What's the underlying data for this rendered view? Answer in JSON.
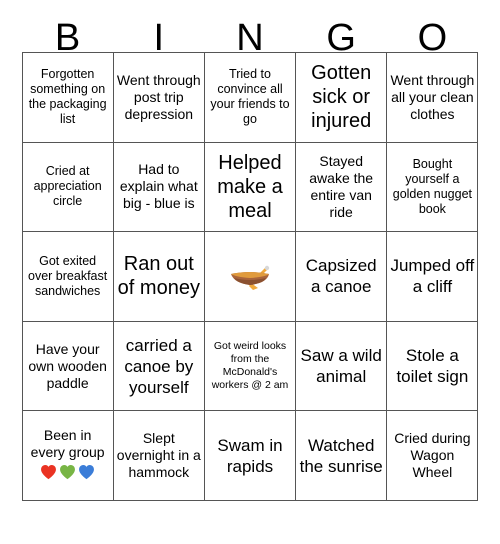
{
  "header": {
    "letters": [
      "B",
      "I",
      "N",
      "G",
      "O"
    ]
  },
  "colors": {
    "grid_border": "#555555",
    "text": "#000000",
    "background": "#ffffff",
    "heart_red": "#ea3323",
    "heart_green": "#78b545",
    "heart_blue": "#3b7dd8",
    "canoe_hull": "#a9643b",
    "canoe_hull_dark": "#8b5130",
    "canoe_inner": "#e09b3d",
    "canoe_paddle": "#f0a93c"
  },
  "grid": {
    "rows": [
      [
        {
          "text": "Forgotten something on the packaging list",
          "size": "fs-sm",
          "kind": "text"
        },
        {
          "text": "Went through post trip depression",
          "size": "fs-md",
          "kind": "text"
        },
        {
          "text": "Tried to convince all your friends to go",
          "size": "fs-sm",
          "kind": "text"
        },
        {
          "text": "Gotten sick or injured",
          "size": "fs-xl",
          "kind": "text"
        },
        {
          "text": "Went through all your clean clothes",
          "size": "fs-md",
          "kind": "text"
        }
      ],
      [
        {
          "text": "Cried at appreciation circle",
          "size": "fs-sm",
          "kind": "text"
        },
        {
          "text": "Had to explain what big - blue is",
          "size": "fs-md",
          "kind": "text"
        },
        {
          "text": "Helped make a meal",
          "size": "fs-xl",
          "kind": "text"
        },
        {
          "text": "Stayed awake the entire van ride",
          "size": "fs-md",
          "kind": "text"
        },
        {
          "text": "Bought yourself a golden nugget book",
          "size": "fs-sm",
          "kind": "text"
        }
      ],
      [
        {
          "text": "Got exited over breakfast sandwiches",
          "size": "fs-sm",
          "kind": "text"
        },
        {
          "text": "Ran out of money",
          "size": "fs-xl",
          "kind": "text"
        },
        {
          "text": "",
          "size": "fs-md",
          "kind": "canoe",
          "icon": "canoe-emoji"
        },
        {
          "text": "Capsized a canoe",
          "size": "fs-lg",
          "kind": "text"
        },
        {
          "text": "Jumped off a cliff",
          "size": "fs-lg",
          "kind": "text"
        }
      ],
      [
        {
          "text": "Have your own wooden paddle",
          "size": "fs-md",
          "kind": "text"
        },
        {
          "text": "carried a canoe by yourself",
          "size": "fs-lg",
          "kind": "text"
        },
        {
          "text": "Got weird looks from the McDonald's workers @ 2 am",
          "size": "fs-xs",
          "kind": "text"
        },
        {
          "text": "Saw a wild animal",
          "size": "fs-lg",
          "kind": "text"
        },
        {
          "text": "Stole a toilet sign",
          "size": "fs-lg",
          "kind": "text"
        }
      ],
      [
        {
          "text": "Been in every group",
          "size": "fs-md",
          "kind": "hearts",
          "hearts": [
            "red",
            "green",
            "blue"
          ]
        },
        {
          "text": "Slept overnight in a hammock",
          "size": "fs-md",
          "kind": "text"
        },
        {
          "text": "Swam in rapids",
          "size": "fs-lg",
          "kind": "text"
        },
        {
          "text": "Watched the sunrise",
          "size": "fs-lg",
          "kind": "text"
        },
        {
          "text": "Cried during Wagon Wheel",
          "size": "fs-md",
          "kind": "text"
        }
      ]
    ]
  }
}
